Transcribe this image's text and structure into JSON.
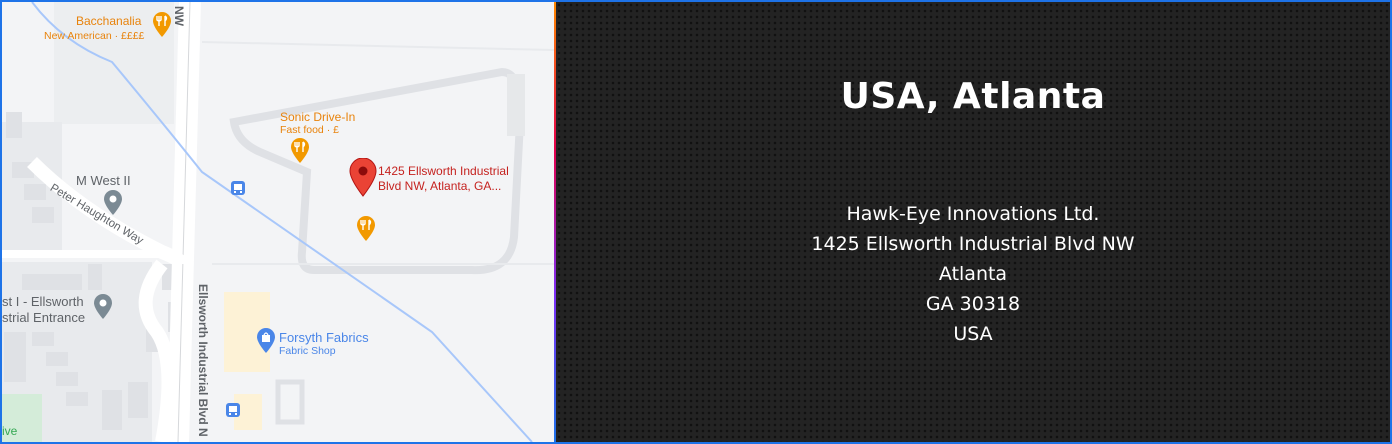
{
  "map": {
    "places": {
      "bacchanalia": {
        "name": "Bacchanalia",
        "sub": "New American · ££££"
      },
      "sonic": {
        "name": "Sonic Drive-In",
        "sub": "Fast food · £"
      },
      "target": {
        "line1": "1425 Ellsworth Industrial",
        "line2": "Blvd NW, Atlanta, GA..."
      },
      "mwest": {
        "name": "M West II"
      },
      "westone": {
        "line1": "st I - Ellsworth",
        "line2": "strial Entrance"
      },
      "forsyth": {
        "name": "Forsyth Fabrics",
        "sub": "Fabric Shop"
      }
    },
    "roads": {
      "peter": "Peter Haughton Way",
      "ellsworth": "Ellsworth Industrial Blvd N",
      "nw": "NW",
      "ive": "ive"
    }
  },
  "office": {
    "title": "USA, Atlanta",
    "address": [
      "Hawk-Eye Innovations Ltd.",
      "1425 Ellsworth Industrial Blvd NW",
      "Atlanta",
      "GA 30318",
      "USA"
    ]
  },
  "colors": {
    "accent": "#1e73e8",
    "pin_red": "#ea4335",
    "food_orange": "#f29900",
    "shop_blue": "#4a86e8"
  }
}
